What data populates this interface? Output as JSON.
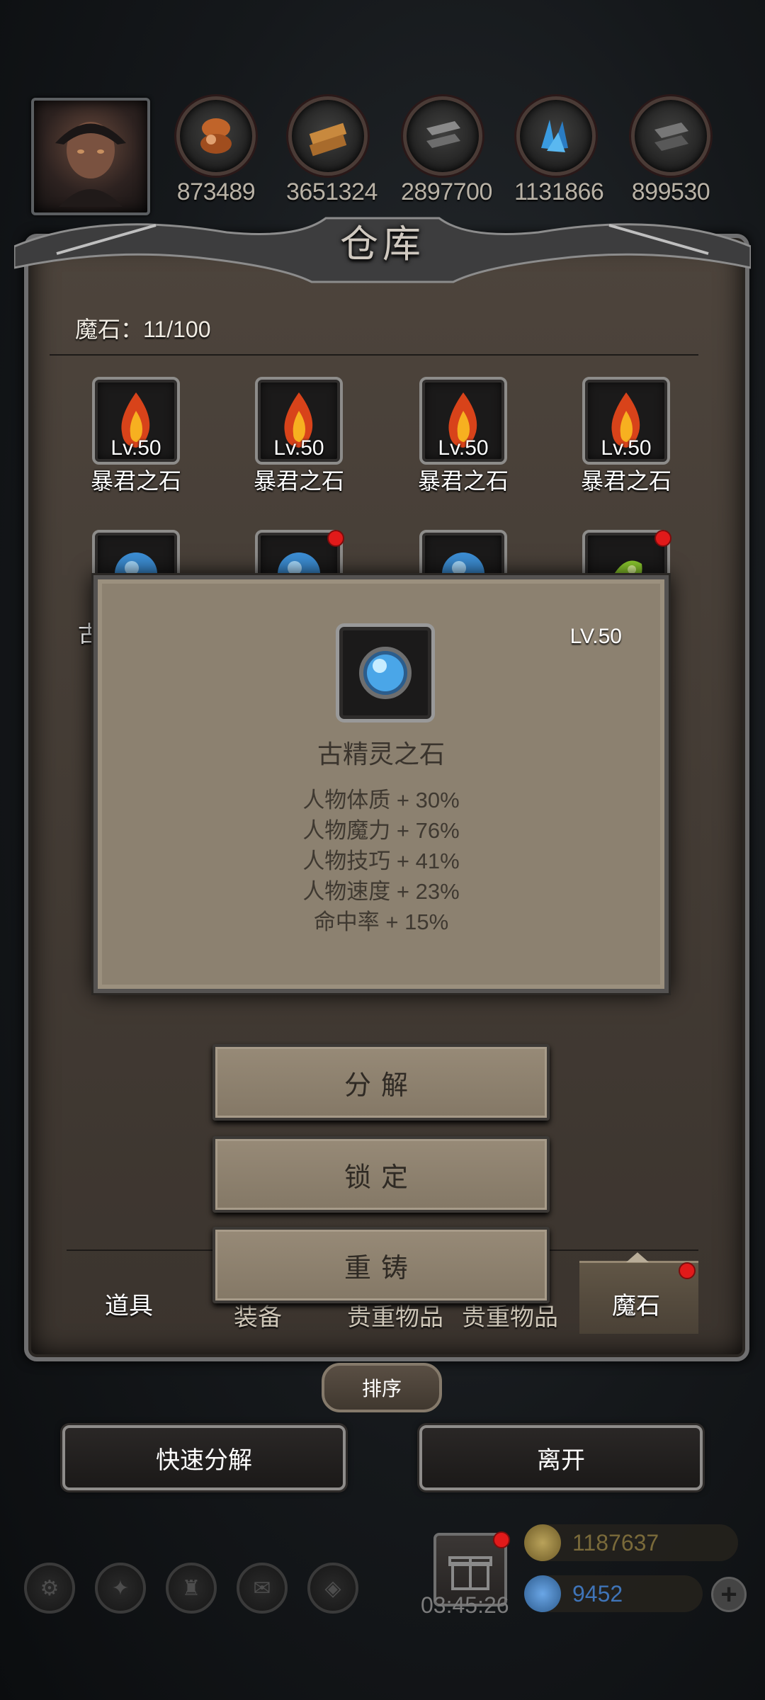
{
  "top_bar": {
    "avatar": "player-avatar",
    "resources": [
      {
        "icon": "wood-log-icon",
        "count": "873489"
      },
      {
        "icon": "plank-icon",
        "count": "3651324"
      },
      {
        "icon": "iron-ingot-icon",
        "count": "2897700"
      },
      {
        "icon": "crystal-icon",
        "count": "1131866"
      },
      {
        "icon": "steel-ingot-icon",
        "count": "899530"
      }
    ]
  },
  "panel": {
    "title": "仓库",
    "stone_label": "魔石：11/100",
    "items": [
      {
        "name": "暴君之石",
        "level": "Lv.50",
        "icon": "fire-stone-icon"
      },
      {
        "name": "暴君之石",
        "level": "Lv.50",
        "icon": "fire-stone-icon"
      },
      {
        "name": "暴君之石",
        "level": "Lv.50",
        "icon": "fire-stone-icon"
      },
      {
        "name": "暴君之石",
        "level": "Lv.50",
        "icon": "fire-stone-icon"
      },
      {
        "name": "古",
        "level": "",
        "icon": "blue-stone-icon"
      },
      {
        "name": "",
        "level": "",
        "icon": "blue-stone-icon"
      },
      {
        "name": "",
        "level": "",
        "icon": "blue-stone-icon"
      },
      {
        "name": "",
        "level": "",
        "icon": "green-stone-icon"
      }
    ]
  },
  "popup": {
    "level": "LV.50",
    "name": "古精灵之石",
    "icon": "blue-orb-stone-icon",
    "stats": [
      "人物体质 + 30%",
      "人物魔力 + 76%",
      "人物技巧 + 41%",
      "人物速度 + 23%",
      "命中率 + 15%"
    ]
  },
  "actions": {
    "decompose": "分解",
    "lock": "锁定",
    "recast": "重铸"
  },
  "tabs": [
    {
      "label": "道具"
    },
    {
      "label": "装备"
    },
    {
      "label": "贵重物品"
    },
    {
      "label": "贵重物品"
    },
    {
      "label": "魔石"
    }
  ],
  "sort_label": "排序",
  "quick_decompose_label": "快速分解",
  "leave_label": "离开",
  "hud": {
    "timer": "03:45:26",
    "gold": "1187637",
    "gems": "9452",
    "colors": {
      "gold": "#7a6a3a",
      "gems": "#3f74b8"
    }
  }
}
